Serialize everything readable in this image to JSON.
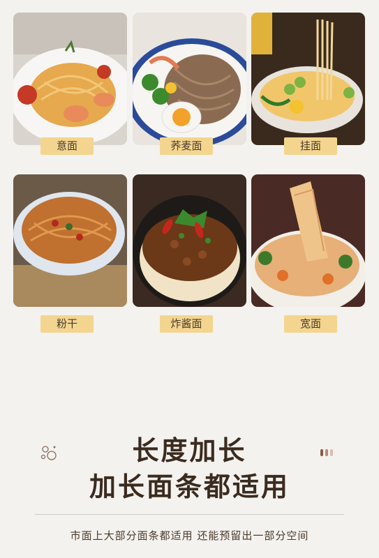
{
  "items": [
    {
      "label": "意面",
      "photo": "spaghetti-shrimp-photo"
    },
    {
      "label": "荞麦面",
      "photo": "buckwheat-noodles-photo"
    },
    {
      "label": "挂面",
      "photo": "noodle-soup-photo"
    },
    {
      "label": "粉干",
      "photo": "rice-vermicelli-photo"
    },
    {
      "label": "炸酱面",
      "photo": "zhajiang-noodles-photo"
    },
    {
      "label": "宽面",
      "photo": "wide-noodles-photo"
    }
  ],
  "heading": {
    "line1": "长度加长",
    "line2": "加长面条都适用"
  },
  "subtitle": "市面上大部分面条都适用 还能预留出一部分空间",
  "colors": {
    "background": "#f4f2ef",
    "label_bg": "#f3d58f",
    "title": "#3b2b1f"
  }
}
